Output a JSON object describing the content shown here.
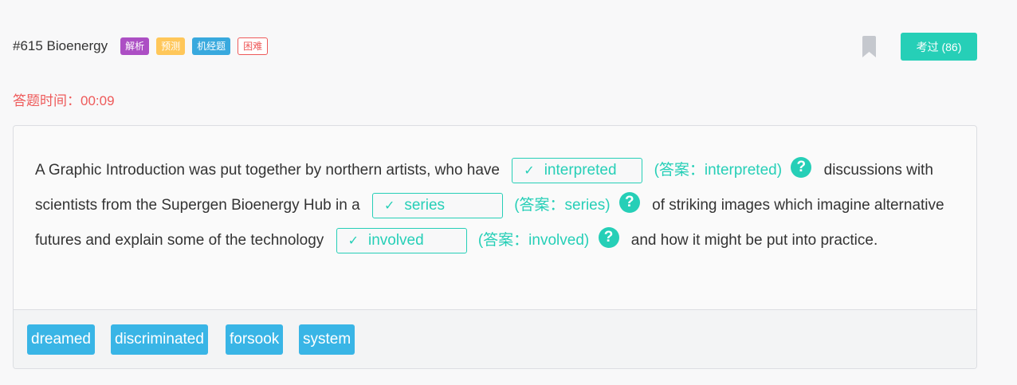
{
  "header": {
    "title": "#615 Bioenergy",
    "tags": [
      "解析",
      "预测",
      "机经题",
      "困难"
    ],
    "exam_button": "考过 (86)",
    "bookmark_icon": "bookmark-icon"
  },
  "timer": "答题时间：00:09",
  "passage": {
    "segments": [
      "A Graphic Introduction was put together by northern artists, who have",
      "discussions with scientists from the Supergen Bioenergy Hub in a",
      "of striking images which imagine alternative futures and explain some of the technology",
      "and how it might be put into practice."
    ],
    "blanks": [
      {
        "value": "interpreted",
        "answer": "(答案：interpreted)"
      },
      {
        "value": "series",
        "answer": "(答案：series)"
      },
      {
        "value": "involved",
        "answer": "(答案：involved)"
      }
    ],
    "check_glyph": "✓",
    "help_glyph": "?"
  },
  "options": [
    "dreamed",
    "discriminated",
    "forsook",
    "system"
  ],
  "colors": {
    "accent": "#26cfb7",
    "danger": "#ee5a5a",
    "option_bg": "#39b5e6"
  }
}
